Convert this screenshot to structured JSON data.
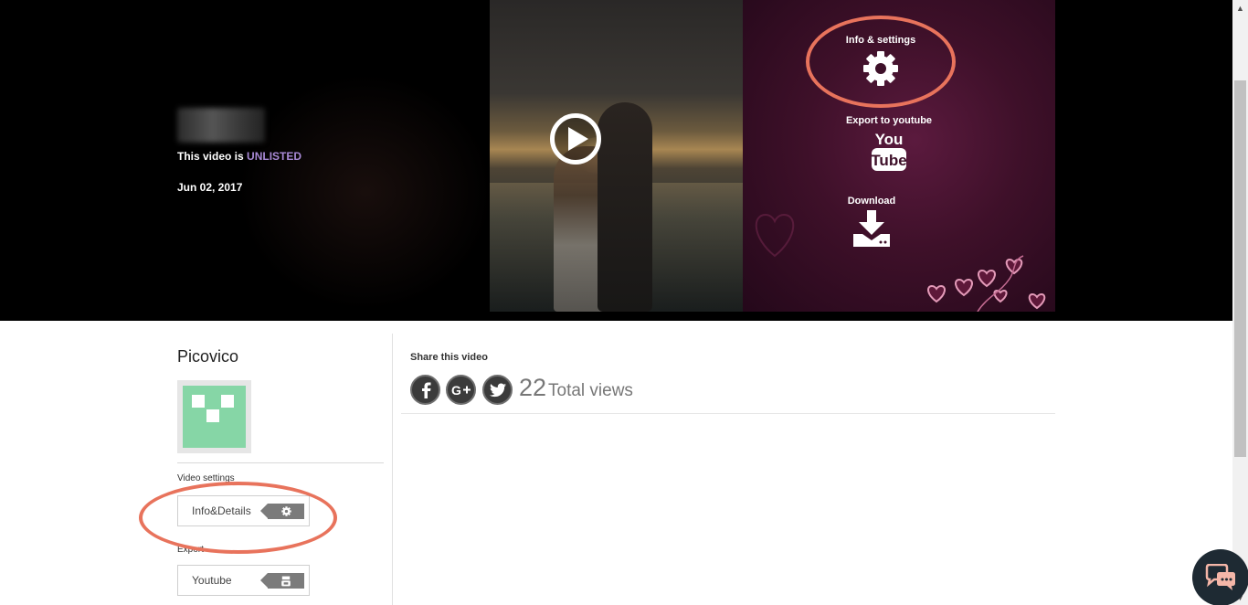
{
  "hero": {
    "unlisted_prefix": "This video is",
    "unlisted_status": "UNLISTED",
    "date": "Jun 02, 2017",
    "actions": {
      "info_label": "Info & settings",
      "info_icon": "gear-icon",
      "export_label": "Export to youtube",
      "export_icon": "youtube-icon",
      "youtube_logo_top": "You",
      "youtube_logo_bottom": "Tube",
      "download_label": "Download",
      "download_icon": "download-icon"
    },
    "highlight_color": "#e8735c",
    "accent_color": "#a98ad6"
  },
  "owner": {
    "name": "Picovico",
    "avatar_color": "#86d6a6"
  },
  "settings": {
    "video_settings_label": "Video settings",
    "export_label": "Export",
    "info_button_label": "Info&Details",
    "info_button_icon": "gear-icon",
    "youtube_button_label": "Youtube",
    "youtube_button_icon": "youtube-icon"
  },
  "share": {
    "title": "Share this video",
    "networks": [
      "facebook-icon",
      "google-plus-icon",
      "twitter-icon"
    ],
    "view_count": "22",
    "views_label": "Total views"
  },
  "chat": {
    "icon": "chat-icon"
  }
}
